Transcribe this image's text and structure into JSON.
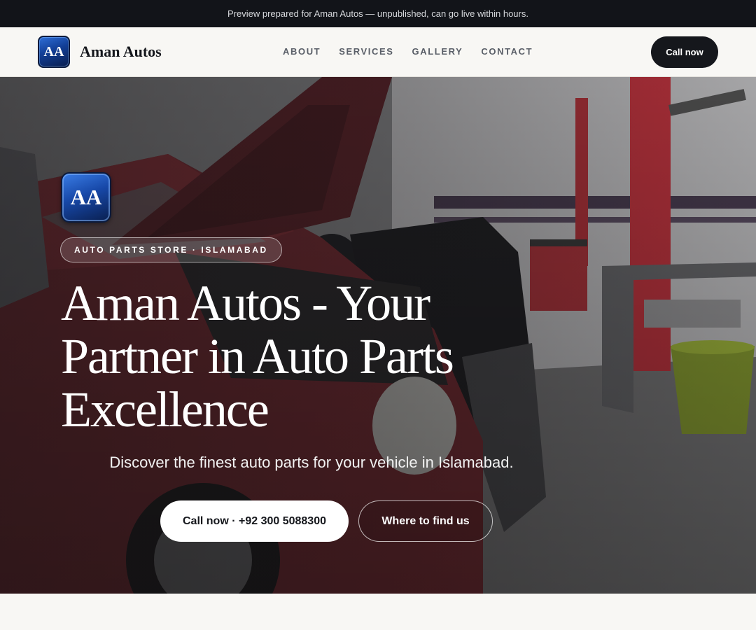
{
  "preview_banner": {
    "text": "Preview prepared for Aman Autos — unpublished, can go live within hours."
  },
  "header": {
    "logo_initials": "AA",
    "brand_name": "Aman Autos",
    "nav": [
      {
        "label": "ABOUT"
      },
      {
        "label": "SERVICES"
      },
      {
        "label": "GALLERY"
      },
      {
        "label": "CONTACT"
      }
    ],
    "cta_label": "Call now"
  },
  "hero": {
    "badge_initials": "AA",
    "eyebrow": "AUTO PARTS STORE · ISLAMABAD",
    "title": "Aman Autos - Your Partner in Auto Parts Excellence",
    "subtitle": "Discover the finest auto parts for your vehicle in Islamabad.",
    "primary_cta": "Call now · +92 300 5088300",
    "secondary_cta": "Where to find us"
  },
  "colors": {
    "dark": "#15171c",
    "banner_bg": "#121419",
    "page_bg": "#f8f7f4",
    "badge_blue": "#1748a8"
  }
}
